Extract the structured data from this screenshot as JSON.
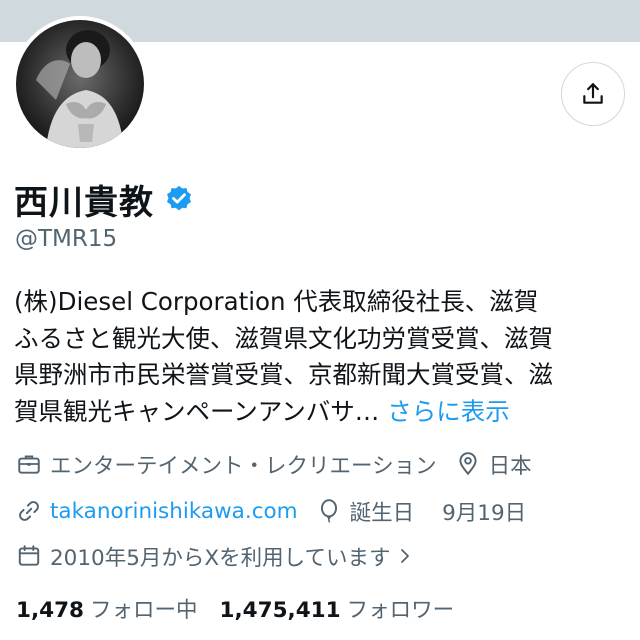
{
  "profile": {
    "display_name": "西川貴教",
    "handle": "@TMR15",
    "bio_lines": [
      "(株)Diesel Corporation 代表取締役社長、滋賀",
      "ふるさと観光大使、滋賀県文化功労賞受賞、滋賀",
      "県野洲市市民栄誉賞受賞、京都新聞大賞受賞、滋",
      "賀県観光キャンペーンアンバサ…"
    ],
    "bio_more": "さらに表示",
    "category": "エンターテイメント・レクリエーション",
    "location": "日本",
    "website": "takanorinishikawa.com",
    "birthday_label": "誕生日",
    "birthday": "9月19日",
    "joined": "2010年5月からXを利用しています"
  },
  "stats": {
    "following_count": "1,478",
    "following_label": "フォロー中",
    "followers_count": "1,475,411",
    "followers_label": "フォロワー"
  },
  "icons": {
    "share": "share-icon",
    "verified": "verified-badge-icon",
    "category": "briefcase-icon",
    "location": "location-pin-icon",
    "website": "link-icon",
    "birthday": "balloon-icon",
    "joined": "calendar-icon",
    "joined_more": "chevron-right-icon"
  },
  "colors": {
    "accent": "#1d9bf0",
    "text_primary": "#0f1419",
    "text_secondary": "#536471",
    "banner": "#cfd9de"
  }
}
